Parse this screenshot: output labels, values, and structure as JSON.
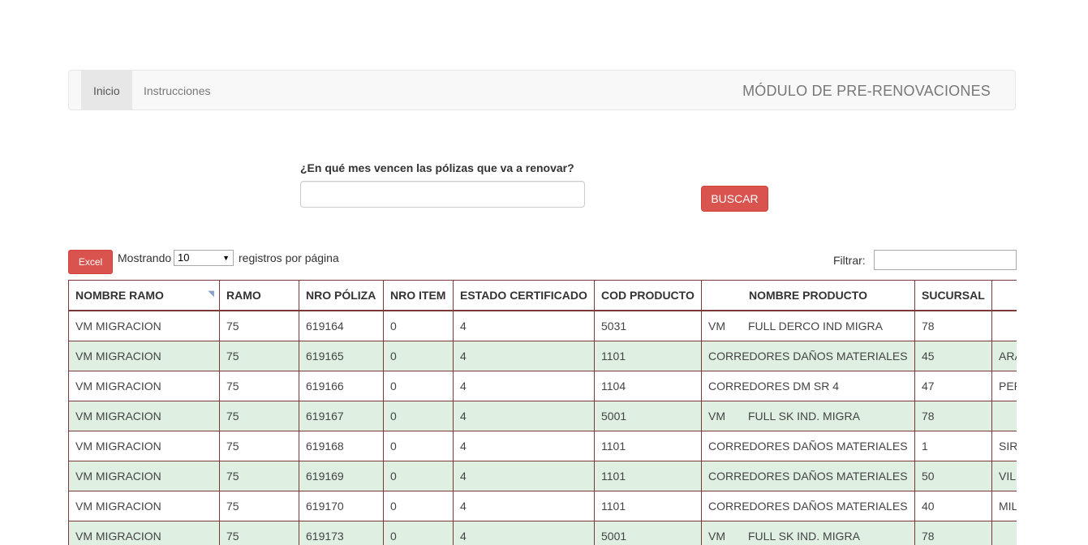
{
  "nav": {
    "items": [
      {
        "label": "Inicio",
        "active": true
      },
      {
        "label": "Instrucciones",
        "active": false
      }
    ],
    "brand": "MÓDULO DE PRE-RENOVACIONES"
  },
  "search": {
    "question": "¿En qué mes vencen las pólizas que va a renovar?",
    "month_value": "",
    "button_label": "BUSCAR"
  },
  "toolbar": {
    "excel_label": "Excel",
    "show_label": "Mostrando",
    "page_size": "10",
    "per_page_label": "registros por página",
    "filter_label": "Filtrar:",
    "filter_value": ""
  },
  "colors": {
    "danger": "#d9534f",
    "row_even": "#dff0e3",
    "border": "#7b3a3a"
  },
  "table": {
    "columns": [
      "NOMBRE RAMO",
      "RAMO",
      "NRO PÓLIZA",
      "NRO ITEM",
      "ESTADO CERTIFICADO",
      "COD PRODUCTO",
      "NOMBRE PRODUCTO",
      "SUCURSAL",
      ""
    ],
    "rows": [
      {
        "nombre_ramo": "VM MIGRACION",
        "ramo": "75",
        "nro_poliza": "619164",
        "nro_item": "0",
        "estado": "4",
        "cod_producto": "5031",
        "prod_prefix": "VM",
        "prod_name": "FULL DERCO IND MIGRA",
        "sucursal": "78",
        "extra": ""
      },
      {
        "nombre_ramo": "VM MIGRACION",
        "ramo": "75",
        "nro_poliza": "619165",
        "nro_item": "0",
        "estado": "4",
        "cod_producto": "1101",
        "prod_prefix": "",
        "prod_name": "CORREDORES DAÑOS MATERIALES",
        "sucursal": "45",
        "extra": "ARA"
      },
      {
        "nombre_ramo": "VM MIGRACION",
        "ramo": "75",
        "nro_poliza": "619166",
        "nro_item": "0",
        "estado": "4",
        "cod_producto": "1104",
        "prod_prefix": "",
        "prod_name": "CORREDORES DM SR 4",
        "sucursal": "47",
        "extra": "PER"
      },
      {
        "nombre_ramo": "VM MIGRACION",
        "ramo": "75",
        "nro_poliza": "619167",
        "nro_item": "0",
        "estado": "4",
        "cod_producto": "5001",
        "prod_prefix": "VM",
        "prod_name": "FULL SK IND. MIGRA",
        "sucursal": "78",
        "extra": ""
      },
      {
        "nombre_ramo": "VM MIGRACION",
        "ramo": "75",
        "nro_poliza": "619168",
        "nro_item": "0",
        "estado": "4",
        "cod_producto": "1101",
        "prod_prefix": "",
        "prod_name": "CORREDORES DAÑOS MATERIALES",
        "sucursal": "1",
        "extra": "SIR"
      },
      {
        "nombre_ramo": "VM MIGRACION",
        "ramo": "75",
        "nro_poliza": "619169",
        "nro_item": "0",
        "estado": "4",
        "cod_producto": "1101",
        "prod_prefix": "",
        "prod_name": "CORREDORES DAÑOS MATERIALES",
        "sucursal": "50",
        "extra": "VILL"
      },
      {
        "nombre_ramo": "VM MIGRACION",
        "ramo": "75",
        "nro_poliza": "619170",
        "nro_item": "0",
        "estado": "4",
        "cod_producto": "1101",
        "prod_prefix": "",
        "prod_name": "CORREDORES DAÑOS MATERIALES",
        "sucursal": "40",
        "extra": "MIL"
      },
      {
        "nombre_ramo": "VM MIGRACION",
        "ramo": "75",
        "nro_poliza": "619173",
        "nro_item": "0",
        "estado": "4",
        "cod_producto": "5001",
        "prod_prefix": "VM",
        "prod_name": "FULL SK IND. MIGRA",
        "sucursal": "78",
        "extra": ""
      }
    ]
  }
}
